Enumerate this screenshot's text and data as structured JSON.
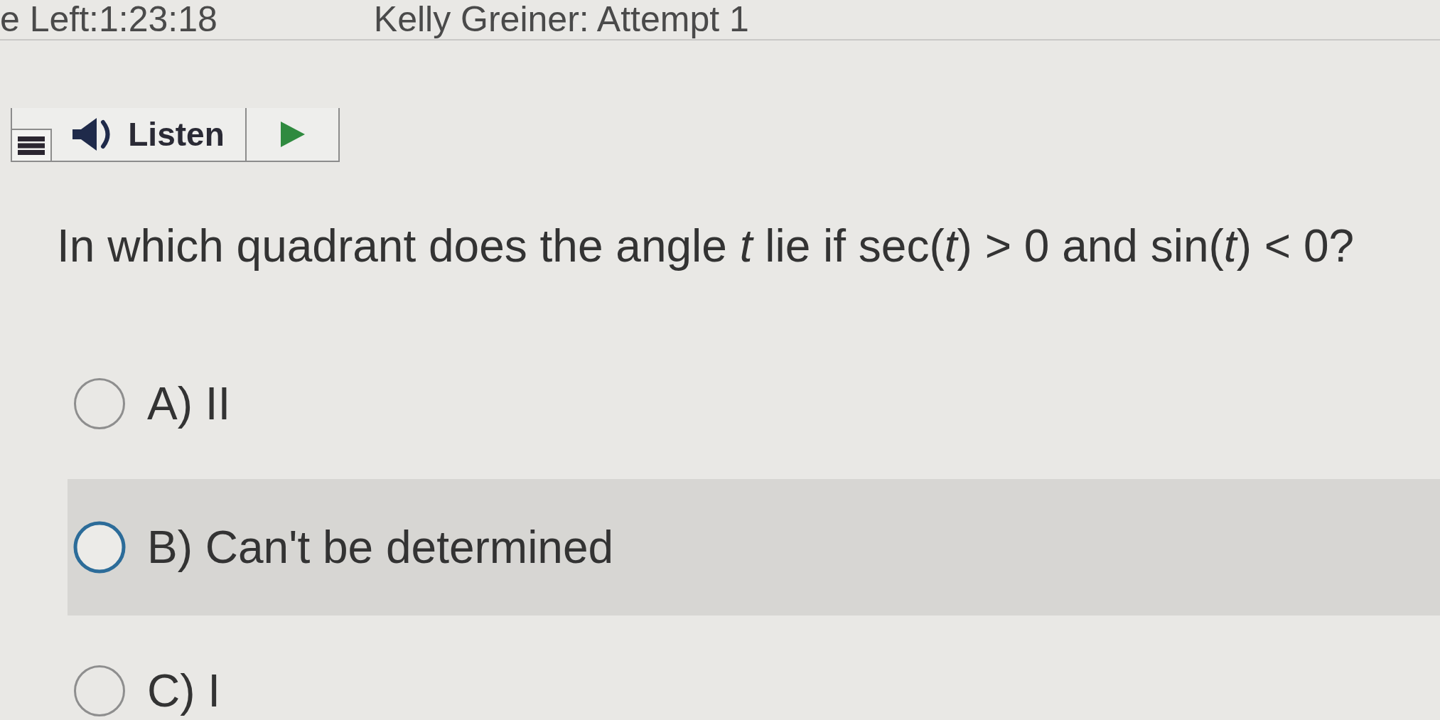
{
  "header": {
    "timer": "e Left:1:23:18",
    "attempt": "Kelly Greiner: Attempt 1"
  },
  "listen_toolbar": {
    "label": "Listen"
  },
  "question": "In which quadrant does the angle *t* lie if sec(*t*) > 0 and sin(*t*) < 0?",
  "options": [
    {
      "label": "A) II",
      "selected": false,
      "highlighted": false
    },
    {
      "label": "B) Can't be determined",
      "selected": false,
      "highlighted": true
    },
    {
      "label": "C) I",
      "selected": false,
      "highlighted": false
    }
  ]
}
